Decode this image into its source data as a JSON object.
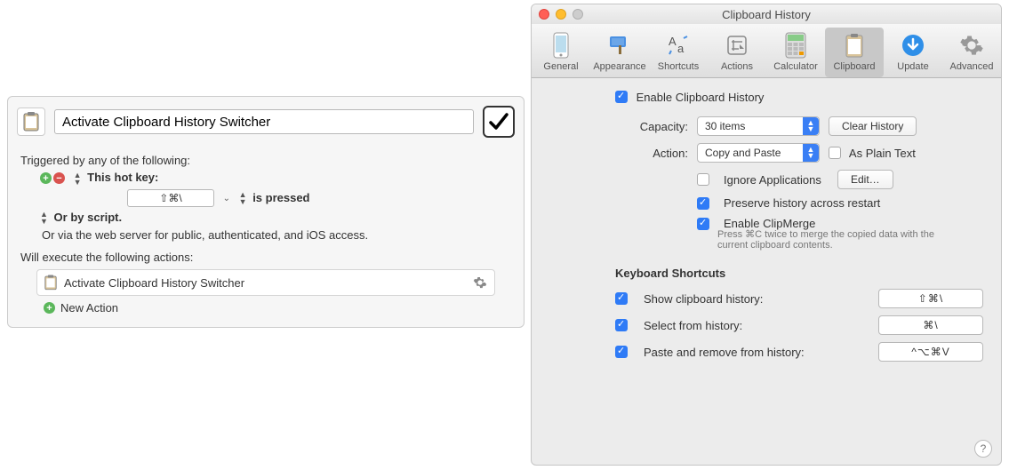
{
  "km": {
    "title_value": "Activate Clipboard History Switcher",
    "triggered_by": "Triggered by any of the following:",
    "hotkey_label": "This hot key:",
    "hotkey_value": "⇧⌘\\",
    "is_pressed": "is pressed",
    "or_by_script": "Or by script.",
    "or_via_web": "Or via the web server for public, authenticated, and iOS access.",
    "will_execute": "Will execute the following actions:",
    "action_label": "Activate Clipboard History Switcher",
    "new_action": "New Action"
  },
  "pref": {
    "window_title": "Clipboard History",
    "toolbar": [
      "General",
      "Appearance",
      "Shortcuts",
      "Actions",
      "Calculator",
      "Clipboard",
      "Update",
      "Advanced"
    ],
    "enable_history": "Enable Clipboard History",
    "capacity_label": "Capacity:",
    "capacity_value": "30 items",
    "clear_history": "Clear History",
    "action_label": "Action:",
    "action_value": "Copy and Paste",
    "as_plain": "As Plain Text",
    "ignore_apps": "Ignore Applications",
    "edit_btn": "Edit…",
    "preserve": "Preserve history across restart",
    "clipmerge": "Enable ClipMerge",
    "clipmerge_hint": "Press ⌘C twice to merge the copied data with the current clipboard contents.",
    "kb_header": "Keyboard Shortcuts",
    "sc_show": "Show clipboard history:",
    "sc_show_val": "⇧⌘\\",
    "sc_select": "Select from history:",
    "sc_select_val": "⌘\\",
    "sc_paste": "Paste and remove from history:",
    "sc_paste_val": "^⌥⌘V"
  }
}
